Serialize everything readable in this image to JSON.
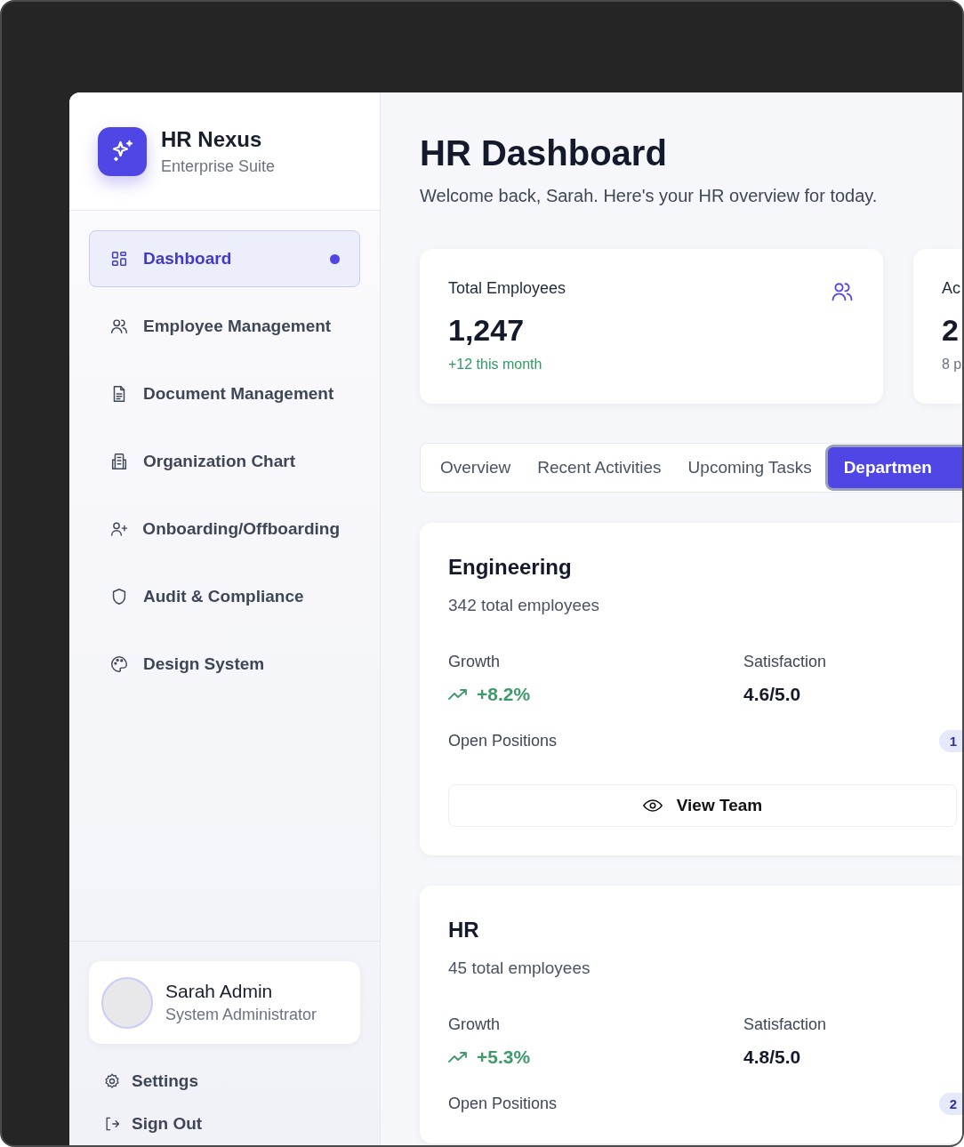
{
  "brand": {
    "name": "HR Nexus",
    "subtitle": "Enterprise Suite"
  },
  "nav": [
    {
      "label": "Dashboard",
      "kind": "grid",
      "selected": true
    },
    {
      "label": "Employee Management",
      "kind": "users",
      "selected": false
    },
    {
      "label": "Document Management",
      "kind": "file",
      "selected": false
    },
    {
      "label": "Organization Chart",
      "kind": "building",
      "selected": false
    },
    {
      "label": "Onboarding/Offboarding",
      "kind": "userplus",
      "selected": false
    },
    {
      "label": "Audit & Compliance",
      "kind": "shield",
      "selected": false
    },
    {
      "label": "Design System",
      "kind": "palette",
      "selected": false
    }
  ],
  "user": {
    "name": "Sarah Admin",
    "role": "System Administrator"
  },
  "footer_links": [
    {
      "label": "Settings",
      "kind": "settings"
    },
    {
      "label": "Sign Out",
      "kind": "signout"
    }
  ],
  "header": {
    "title": "HR Dashboard",
    "subtitle": "Welcome back, Sarah. Here's your HR overview for today."
  },
  "stats": [
    {
      "label": "Total Employees",
      "value": "1,247",
      "note": "+12 this month",
      "positive": true
    },
    {
      "label": "Ac",
      "value": "2",
      "note": "8 p",
      "positive": false
    }
  ],
  "tabs": [
    {
      "label": "Overview",
      "selected": false
    },
    {
      "label": "Recent Activities",
      "selected": false
    },
    {
      "label": "Upcoming Tasks",
      "selected": false
    },
    {
      "label": "Departmen",
      "selected": true
    }
  ],
  "departments": [
    {
      "name": "Engineering",
      "employees": "342 total employees",
      "growth_label": "Growth",
      "growth": "+8.2%",
      "satisfaction_label": "Satisfaction",
      "satisfaction": "4.6/5.0",
      "positions_label": "Open Positions",
      "positions": "1",
      "button": "View Team"
    },
    {
      "name": "HR",
      "employees": "45 total employees",
      "growth_label": "Growth",
      "growth": "+5.3%",
      "satisfaction_label": "Satisfaction",
      "satisfaction": "4.8/5.0",
      "positions_label": "Open Positions",
      "positions": "2"
    }
  ]
}
